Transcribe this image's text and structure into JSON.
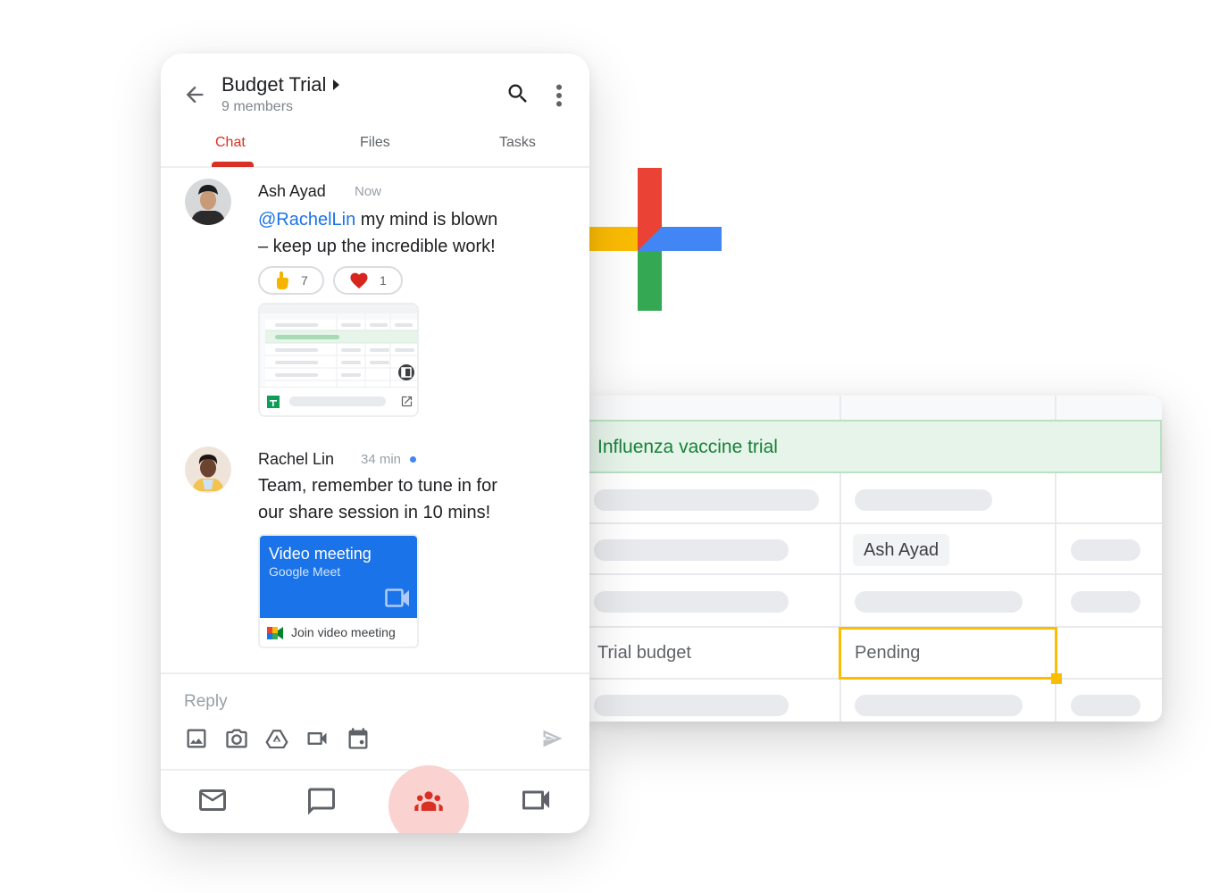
{
  "phone": {
    "header": {
      "title": "Budget Trial",
      "subtitle": "9 members",
      "back_icon": "arrow-left-icon",
      "search_icon": "search-icon",
      "more_icon": "more-vert-icon"
    },
    "tabs": [
      {
        "label": "Chat",
        "active": true
      },
      {
        "label": "Files",
        "active": false
      },
      {
        "label": "Tasks",
        "active": false
      }
    ],
    "messages": [
      {
        "author": "Ash Ayad",
        "time": "Now",
        "mention": "@RachelLin",
        "text_line1": " my mind is blown",
        "text_line2": "– keep up the incredible work!",
        "reactions": [
          {
            "emoji": "☝️",
            "count": "7"
          },
          {
            "emoji": "❤️",
            "count": "1"
          }
        ],
        "attachment": {
          "type": "google-sheets-preview",
          "icon": "sheets-icon",
          "open_icon": "open-in-new-icon"
        }
      },
      {
        "author": "Rachel Lin",
        "time": "34 min",
        "unread": true,
        "text_line1": "Team, remember to tune in for",
        "text_line2": "our share session in 10 mins!",
        "meeting_card": {
          "title": "Video meeting",
          "subtitle": "Google Meet",
          "join_label": "Join video meeting"
        }
      }
    ],
    "composer": {
      "placeholder": "Reply",
      "value": "",
      "tools": [
        "image-icon",
        "camera-icon",
        "drive-icon",
        "video-icon",
        "calendar-icon"
      ],
      "send_icon": "send-icon"
    },
    "bottom_nav": [
      {
        "name": "mail",
        "icon": "mail-icon",
        "active": false
      },
      {
        "name": "chat",
        "icon": "chat-icon",
        "active": false
      },
      {
        "name": "spaces",
        "icon": "people-icon",
        "active": true
      },
      {
        "name": "meet",
        "icon": "video-icon",
        "active": false
      }
    ]
  },
  "sheet": {
    "title": "Influenza vaccine trial",
    "assignee_chip": "Ash Ayad",
    "row_label": "Trial budget",
    "selected_cell_value": "Pending"
  },
  "colors": {
    "accent_red": "#d93025",
    "meet_blue": "#1a73e8",
    "sheet_green": "#188038",
    "selection_yellow": "#fbbc04",
    "google_red": "#ea4335",
    "google_blue": "#4285f4",
    "google_yellow": "#fbbc04",
    "google_green": "#34a853"
  }
}
